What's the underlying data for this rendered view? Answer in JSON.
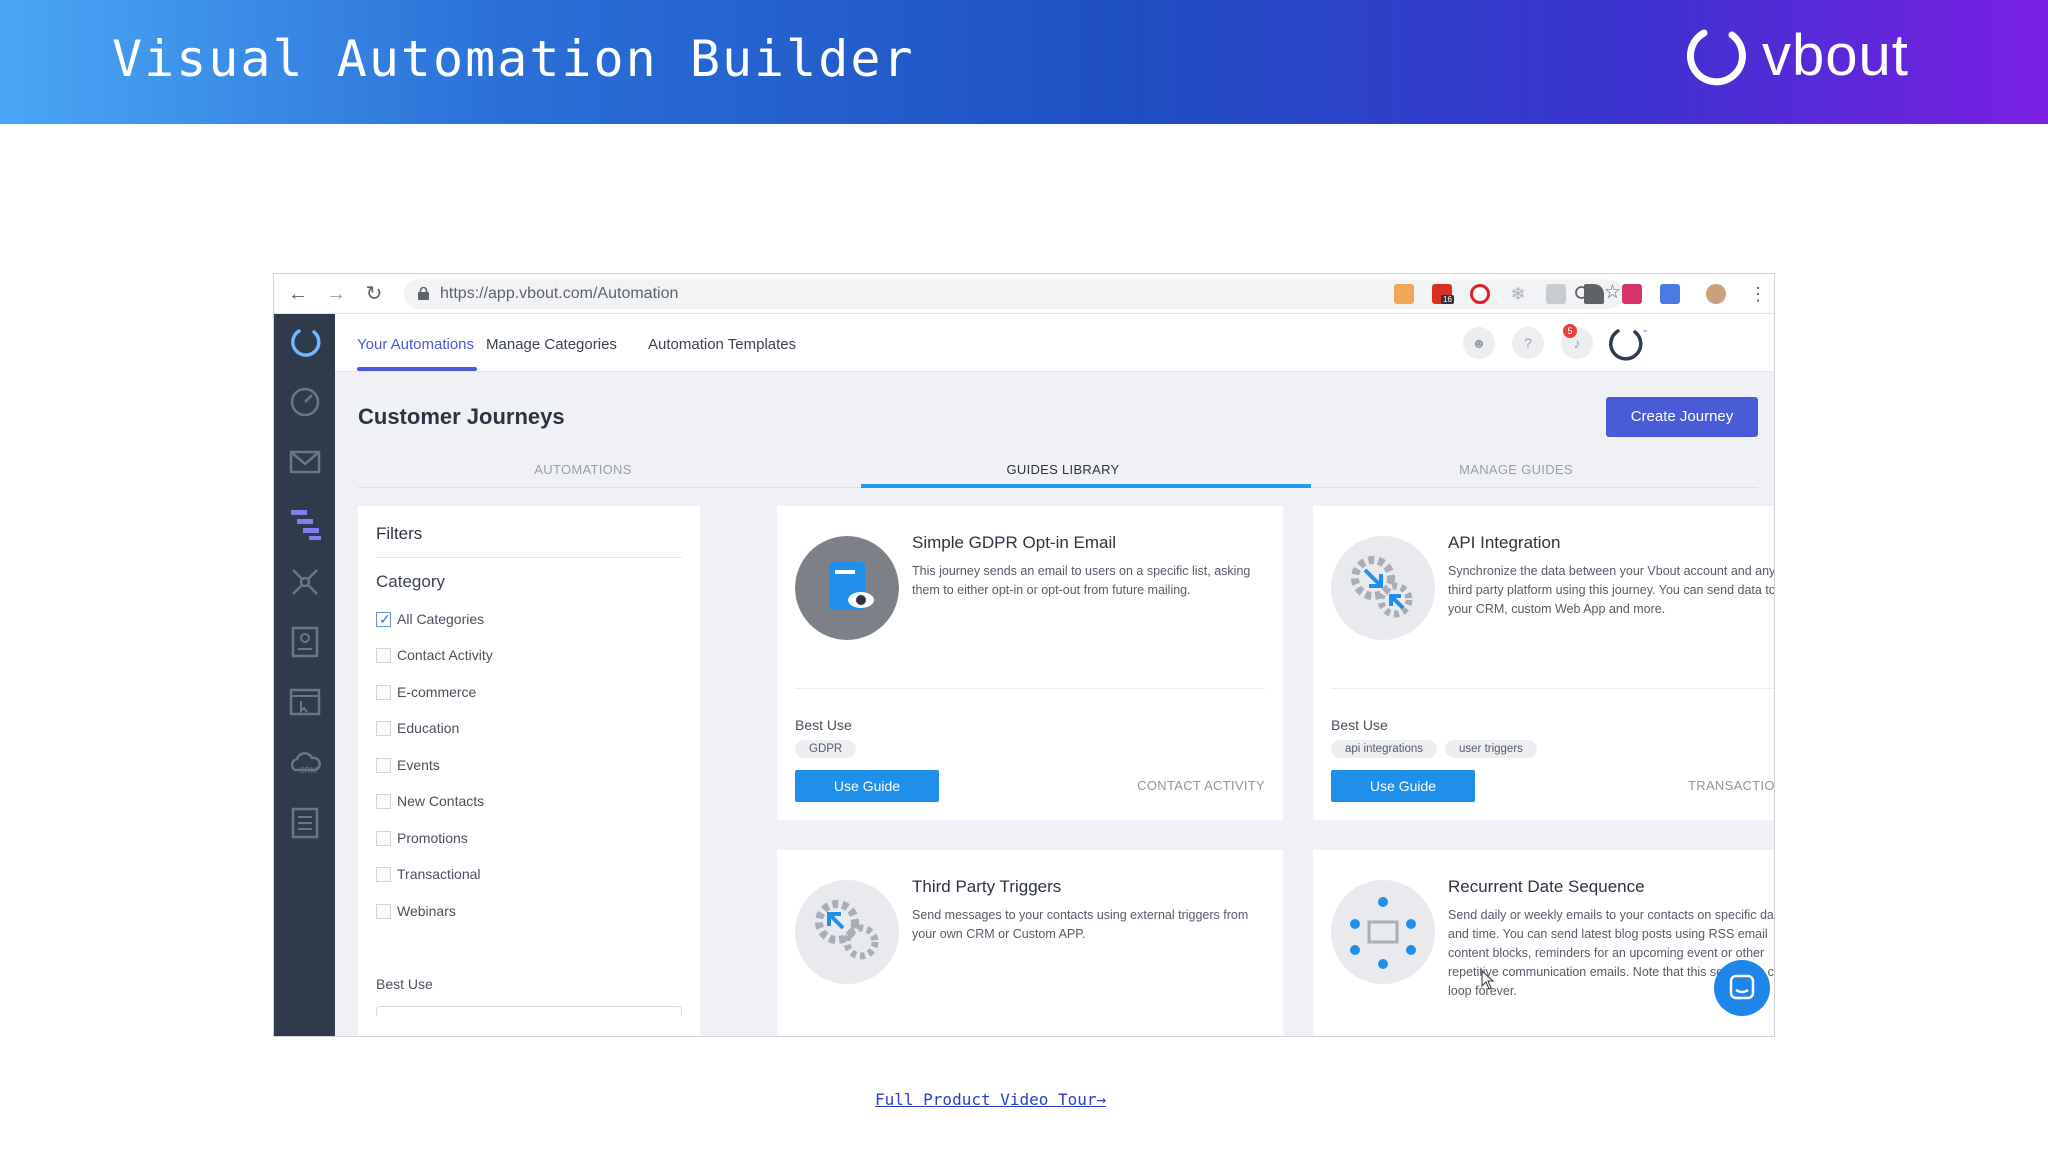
{
  "banner": {
    "title": "Visual Automation Builder",
    "brand_name": "vbout",
    "gradient_colors": [
      "#4aa6f5",
      "#1f4fc2",
      "#7a1fe3"
    ]
  },
  "browser": {
    "url": "https://app.vbout.com/Automation",
    "ext_badge": "16"
  },
  "app": {
    "sidebar_items": [
      "logo-icon",
      "dashboard-icon",
      "email-icon",
      "automation-icon",
      "network-icon",
      "contacts-icon",
      "landing-page-icon",
      "crm-icon",
      "tasks-icon"
    ],
    "crm_label": "CRM",
    "topnav": {
      "tabs": [
        "Your Automations",
        "Manage Categories",
        "Automation Templates"
      ],
      "active_tab": "Your Automations",
      "help_label": "?",
      "notification_count": "5"
    },
    "page_title": "Customer Journeys",
    "create_button": "Create Journey",
    "content_tabs": [
      "AUTOMATIONS",
      "GUIDES LIBRARY",
      "MANAGE GUIDES"
    ],
    "active_content_tab": "GUIDES LIBRARY",
    "filters": {
      "title": "Filters",
      "category_title": "Category",
      "categories": [
        "All Categories",
        "Contact Activity",
        "E-commerce",
        "Education",
        "Events",
        "New Contacts",
        "Promotions",
        "Transactional",
        "Webinars"
      ],
      "checked": "All Categories",
      "best_use_title": "Best Use"
    },
    "guides": [
      {
        "title": "Simple GDPR Opt-in Email",
        "description": "This journey sends an email to users on a specific list, asking them to either opt-in or opt-out from future mailing.",
        "best_use_label": "Best Use",
        "tags": [
          "GDPR"
        ],
        "button": "Use Guide",
        "category": "CONTACT ACTIVITY",
        "icon": "book-eye-icon"
      },
      {
        "title": "API Integration",
        "description": "Synchronize the data between your Vbout account and any third party platform using this journey. You can send data to your CRM, custom Web App and more.",
        "best_use_label": "Best Use",
        "tags": [
          "api integrations",
          "user triggers"
        ],
        "button": "Use Guide",
        "category": "TRANSACTIONAL",
        "icon": "gears-arrows-icon"
      },
      {
        "title": "Third Party Triggers",
        "description": "Send messages to your contacts using external triggers from your own CRM or Custom APP.",
        "icon": "gears-trigger-icon"
      },
      {
        "title": "Recurrent Date Sequence",
        "description": "Send daily or weekly emails to your contacts on specific day and time. You can send latest blog posts using RSS email content blocks, reminders for an upcoming event or other repetitive communication emails. Note that this sequence can loop forever.",
        "icon": "people-calendar-icon"
      }
    ]
  },
  "footer": {
    "tour_link": "Full Product Video Tour→"
  },
  "colors": {
    "accent": "#4a5bd6",
    "tab_accent": "#1f9be8",
    "button_blue": "#1f8fea",
    "sidebar": "#2f3a4a"
  }
}
